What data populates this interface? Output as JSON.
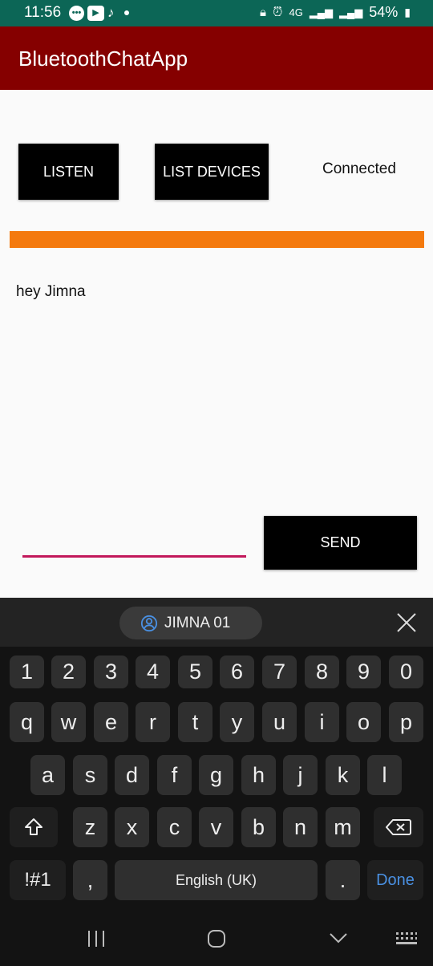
{
  "status_bar": {
    "time": "11:56",
    "battery": "54%",
    "network": "4G",
    "icons": [
      "chat-bubble-icon",
      "youtube-icon",
      "tiktok-icon",
      "dot-icon",
      "alarm-icon",
      "signal-icon",
      "battery-icon"
    ]
  },
  "app": {
    "title": "BluetoothChatApp",
    "listen_label": "LISTEN",
    "list_devices_label": "LIST DEVICES",
    "status": "Connected",
    "message": "hey Jimna",
    "send_label": "SEND",
    "accent_color": "#850000",
    "bar_color": "#f47a0e"
  },
  "keyboard": {
    "suggestion": "JIMNA 01",
    "row_numbers": [
      "1",
      "2",
      "3",
      "4",
      "5",
      "6",
      "7",
      "8",
      "9",
      "0"
    ],
    "row1": [
      "q",
      "w",
      "e",
      "r",
      "t",
      "y",
      "u",
      "i",
      "o",
      "p"
    ],
    "row2": [
      "a",
      "s",
      "d",
      "f",
      "g",
      "h",
      "j",
      "k",
      "l"
    ],
    "row3": [
      "z",
      "x",
      "c",
      "v",
      "b",
      "n",
      "m"
    ],
    "symbols_label": "!#1",
    "comma": ",",
    "space_label": "English (UK)",
    "period": ".",
    "done_label": "Done"
  }
}
